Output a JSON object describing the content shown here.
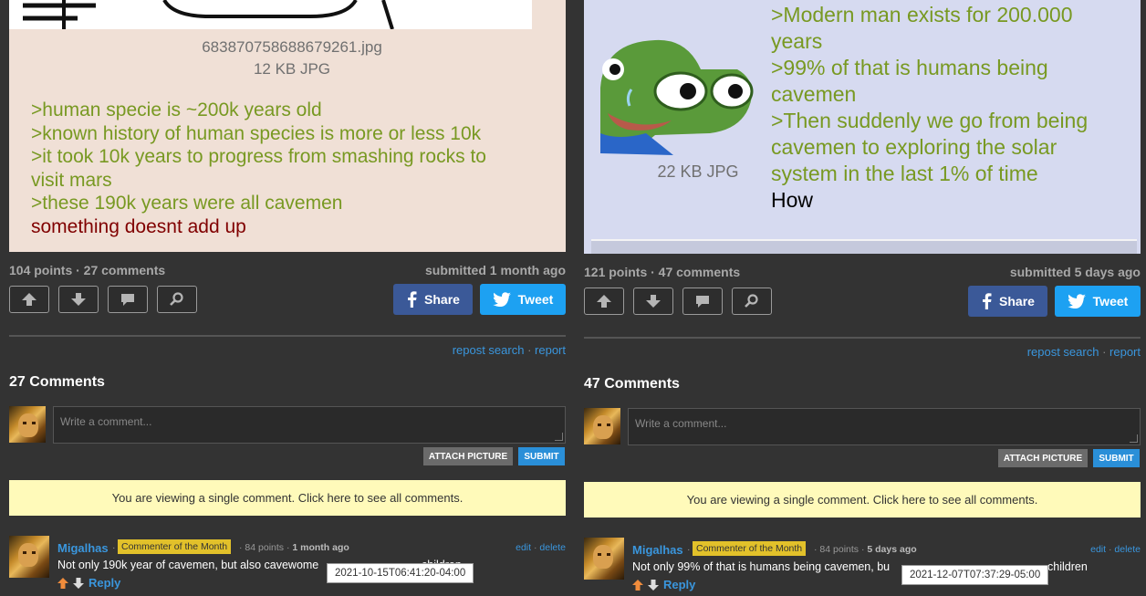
{
  "left": {
    "file_name": "683870758688679261.jpg",
    "file_size": "12 KB JPG",
    "post_lines": [
      ">human specie is ~200k years old",
      ">known history of human species is more or less 10k",
      ">it took 10k years to progress from smashing rocks to",
      "visit mars",
      ">these 190k years were all cavemen",
      "something doesnt add up"
    ],
    "stats": "104 points · 27 comments",
    "submitted": "submitted 1 month ago",
    "share_label": "Share",
    "tweet_label": "Tweet",
    "repost_search": "repost search",
    "report": "report",
    "comments_title": "27 Comments",
    "comment_placeholder": "Write a comment...",
    "attach_label": "ATTACH PICTURE",
    "submit_label": "SUBMIT",
    "notice": "You are viewing a single comment. Click here to see all comments.",
    "comment": {
      "author": "Migalhas",
      "badge": "Commenter of the Month",
      "points": "84 points",
      "age": "1 month ago",
      "edit": "edit",
      "delete": "delete",
      "text": "Not only 190k year of cavemen, but also cavewome",
      "text_tail": "children",
      "reply": "Reply",
      "tooltip": "2021-10-15T06:41:20-04:00"
    }
  },
  "right": {
    "file_size": "22 KB JPG",
    "post_lines": [
      ">Modern man exists for 200.000",
      "years",
      ">99% of that is humans being",
      "cavemen",
      ">Then suddenly we go from being",
      "cavemen to exploring the solar",
      "system in the last 1% of time",
      "How"
    ],
    "stats": "121 points · 47 comments",
    "submitted": "submitted 5 days ago",
    "share_label": "Share",
    "tweet_label": "Tweet",
    "repost_search": "repost search",
    "report": "report",
    "comments_title": "47 Comments",
    "comment_placeholder": "Write a comment...",
    "attach_label": "ATTACH PICTURE",
    "submit_label": "SUBMIT",
    "notice": "You are viewing a single comment. Click here to see all comments.",
    "comment": {
      "author": "Migalhas",
      "badge": "Commenter of the Month",
      "points": "84 points",
      "age": "5 days ago",
      "edit": "edit",
      "delete": "delete",
      "text": "Not only 99% of that is humans being cavemen, bu",
      "text_tail": "children",
      "reply": "Reply",
      "tooltip": "2021-12-07T07:37:29-05:00"
    }
  },
  "colors": {
    "background": "#333333",
    "greentext": "#789922",
    "link": "#3a96dd",
    "facebook": "#3b5998",
    "twitter": "#1da1f2",
    "notice": "#fffaba",
    "badge": "#e2c12a"
  },
  "icons": {
    "upvote": "arrow-up-icon",
    "downvote": "arrow-down-icon",
    "comment": "speech-bubble-icon",
    "search": "magnifier-icon",
    "facebook": "facebook-icon",
    "twitter": "twitter-bird-icon"
  }
}
